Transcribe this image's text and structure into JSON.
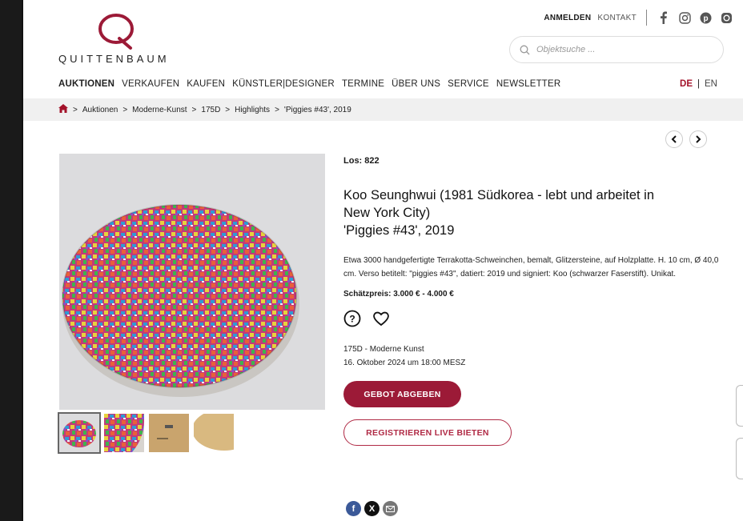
{
  "header": {
    "logo_text": "QUITTENBAUM",
    "login": "ANMELDEN",
    "contact": "KONTAKT",
    "social_icons": [
      "facebook-icon",
      "instagram-icon",
      "pinterest-icon",
      "other-social-icon"
    ]
  },
  "search": {
    "placeholder": "Objektsuche ..."
  },
  "nav": {
    "items": [
      "AUKTIONEN",
      "VERKAUFEN",
      "KAUFEN",
      "KÜNSTLER|DESIGNER",
      "TERMINE",
      "ÜBER UNS",
      "SERVICE",
      "NEWSLETTER"
    ],
    "lang_de": "DE",
    "lang_sep": "|",
    "lang_en": "EN"
  },
  "breadcrumb": [
    "Auktionen",
    "Moderne-Kunst",
    "175D",
    "Highlights",
    "'Piggies #43', 2019"
  ],
  "lot": {
    "label": "Los: 822",
    "artist_line1": "Koo Seunghwui (1981 Südkorea - lebt und arbeitet in",
    "artist_line2": "New York City)",
    "title": "'Piggies #43', 2019",
    "description": "Etwa 3000 handgefertigte Terrakotta-Schweinchen, bemalt, Glitzersteine, auf Holzplatte. H. 10 cm, Ø 40,0 cm. Verso betitelt: \"piggies #43\", datiert: 2019 und signiert: Koo (schwarzer Faserstift). Unikat.",
    "estimate": "Schätzpreis: 3.000 € - 4.000 €",
    "sale_line1": "175D - Moderne Kunst",
    "sale_line2": "16. Oktober 2024 um 18:00 MESZ",
    "bid_button": "GEBOT ABGEBEN",
    "live_button": "REGISTRIEREN LIVE BIETEN"
  },
  "colors": {
    "brand": "#9c1a37",
    "breadcrumb_bg": "#f0f0f0"
  }
}
